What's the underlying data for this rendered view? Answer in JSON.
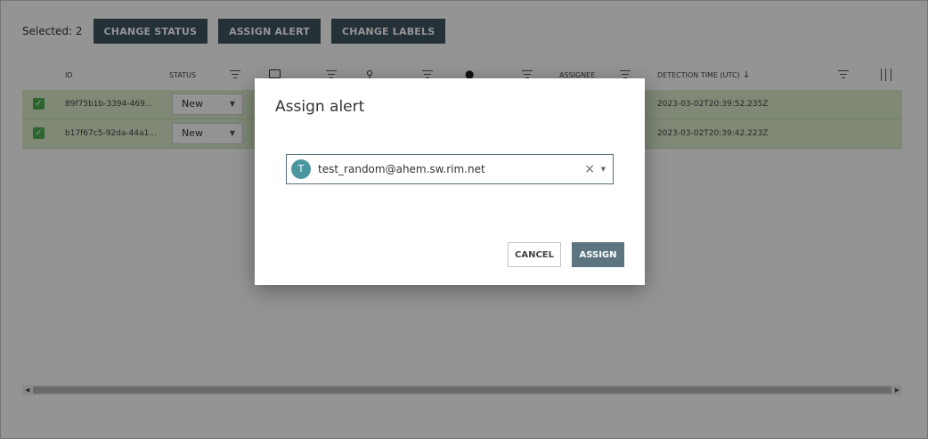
{
  "toolbar": {
    "selected_label": "Selected: 2",
    "buttons": [
      "CHANGE STATUS",
      "ASSIGN ALERT",
      "CHANGE LABELS"
    ]
  },
  "table": {
    "headers": {
      "id": "ID",
      "status": "STATUS",
      "assignee": "ASSIGNEE",
      "detection_time": "DETECTION TIME (UTC)",
      "sort_indicator": "↓"
    },
    "rows": [
      {
        "id": "89f75b1b-3394-469...",
        "status": "New",
        "detection_time": "2023-03-02T20:39:52.235Z"
      },
      {
        "id": "b17f67c5-92da-44a1...",
        "status": "New",
        "detection_time": "2023-03-02T20:39:42.223Z"
      }
    ]
  },
  "dialog": {
    "title": "Assign alert",
    "assignee": {
      "avatar_initial": "T",
      "value": "test_random@ahem.sw.rim.net"
    },
    "cancel_label": "CANCEL",
    "assign_label": "ASSIGN"
  },
  "icons": {
    "checkbox": "check-icon",
    "filter": "filter-icon",
    "columns": "column-chooser-icon",
    "clear": "×",
    "dropdown": "▼"
  },
  "colors": {
    "toolbar_button": "#3e5560",
    "selected_row": "#dbeccc",
    "checkbox": "#4caf50",
    "avatar": "#4b97a0",
    "assign_button": "#5c7581"
  }
}
